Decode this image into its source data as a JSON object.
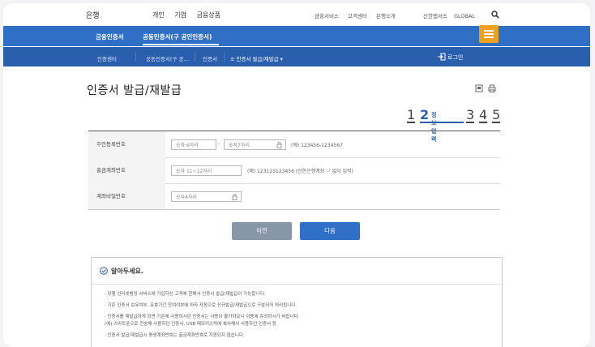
{
  "header": {
    "brand": "은행",
    "main_nav": [
      "개인",
      "기업",
      "금융상품"
    ],
    "sub_nav": [
      "금융서비스",
      "고객센터",
      "은행소개"
    ],
    "langs": [
      "신한앱서스",
      "GLOBAL"
    ]
  },
  "blue_bar": {
    "left_title": "금융인증서",
    "tab_label": "공동인증서(구 공인인증서)"
  },
  "breadcrumb": {
    "items": [
      "인증센터",
      "공동인증서(구 공…",
      "인증서",
      "≡ 인증서 발급/재발급 ▾"
    ],
    "login": "로그인"
  },
  "page": {
    "title": "인증서 발급/재발급"
  },
  "steps": {
    "numbers": [
      "1",
      "2",
      "3",
      "4",
      "5"
    ],
    "active_label": "정보입력"
  },
  "form": {
    "rows": [
      {
        "label": "주민등록번호",
        "input1_placeholder": "숫자 6자리",
        "dash": "-",
        "input2_placeholder": "숫자7자리",
        "hint": "(예) 123456-1234567"
      },
      {
        "label": "출금계좌번호",
        "input1_placeholder": "숫자 11~12자리",
        "hint": "(예) 123123123456 (신한은행계좌 '-' 없이 입력)"
      },
      {
        "label": "계좌비밀번호",
        "input1_placeholder": "숫자4자리"
      }
    ]
  },
  "buttons": {
    "prev": "이전",
    "next": "다음"
  },
  "notice": {
    "title": "알아두세요.",
    "lines": [
      "· 당행 인터넷뱅킹 서비스에 가입하신 고객에 한해서 인증서 발급/재발급이 가능합니다.",
      "· 기존 인증서 보유여부, 유효기간 잔여여부에 따라 자동으로 신규발급/재발급으로 구분되어 처리됩니다.",
      "· 인증서를 재발급하게 되면 기존에 사용하시던 인증서는 사용이 불가하오니 이용에 유의하시기 바랍니다.",
      "  (예) 스마트폰으로 전송해 사용하던 인증서, USB 메모리스틱에 복사해서 사용하던 인증서 등",
      "· 인증서 발급/재발급시 평생계좌번호는 출금계좌번호로 지원되지 않습니다."
    ]
  },
  "colors": {
    "blue_primary": "#2f6fc5",
    "blue_dark": "#2a5fae",
    "accent_orange": "#f0a020"
  }
}
